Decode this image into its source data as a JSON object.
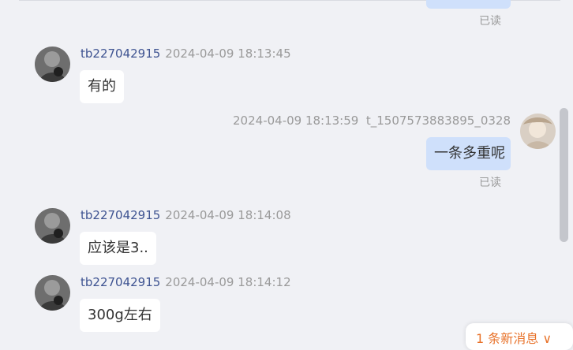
{
  "read_label": "已读",
  "messages": [
    {
      "sender": "tb227042915",
      "time": "2024-04-09 18:13:45",
      "text": "有的"
    },
    {
      "sender": "t_1507573883895_0328",
      "time": "2024-04-09 18:13:59",
      "text": "一条多重呢"
    },
    {
      "sender": "tb227042915",
      "time": "2024-04-09 18:14:08",
      "text": "应该是3.."
    },
    {
      "sender": "tb227042915",
      "time": "2024-04-09 18:14:12",
      "text": "300g左右"
    }
  ],
  "new_message_notice": "1 条新消息",
  "new_message_chevron": "∨",
  "colors": {
    "background": "#f0f1f5",
    "outgoing_bubble": "#cfe0fb",
    "incoming_bubble": "#ffffff",
    "username": "#3e5391",
    "notice": "#e8722a"
  }
}
